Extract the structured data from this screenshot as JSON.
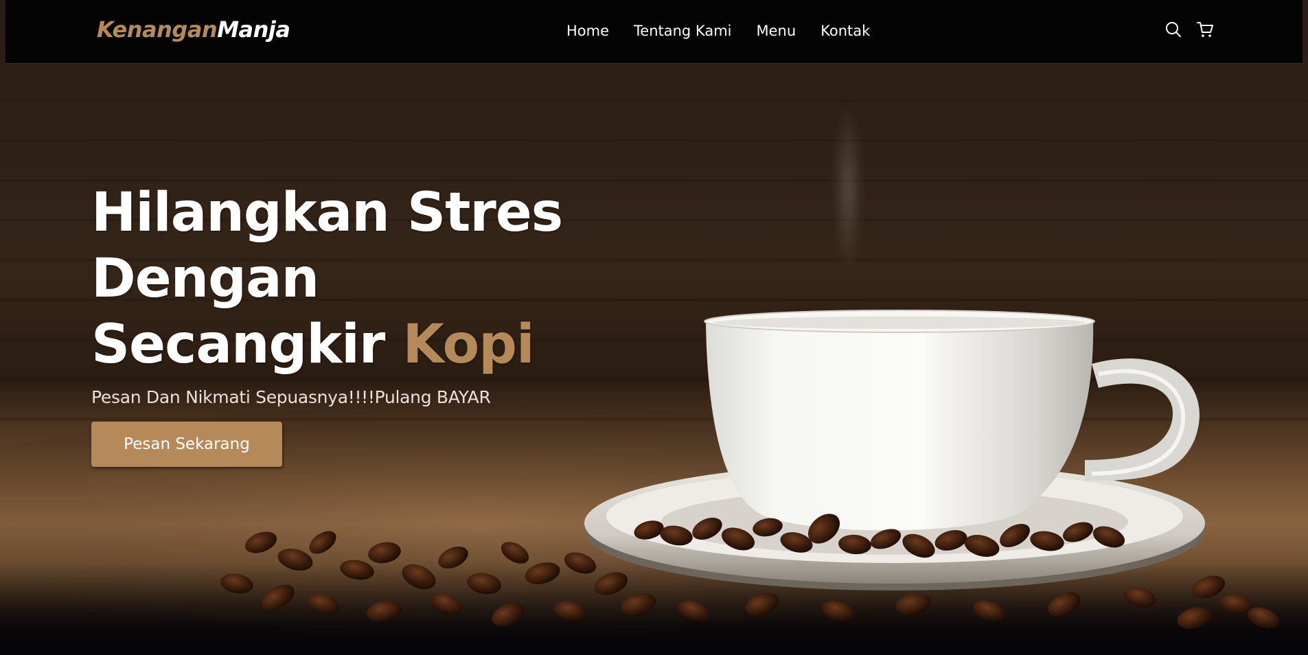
{
  "brand": {
    "name_part1": "Kenangan",
    "name_part2": "Manja",
    "accent_color": "#b6895b"
  },
  "navbar": {
    "links": [
      {
        "label": "Home"
      },
      {
        "label": "Tentang Kami"
      },
      {
        "label": "Menu"
      },
      {
        "label": "Kontak"
      }
    ],
    "icons": [
      "search-icon",
      "shopping-cart-icon"
    ]
  },
  "hero": {
    "title_line1": "Hilangkan Stres",
    "title_line2": "Dengan",
    "title_line3_plain": "Secangkir ",
    "title_line3_accent": "Kopi",
    "subtitle": "Pesan Dan Nikmati Sepuasnya!!!!Pulang BAYAR",
    "cta_label": "Pesan Sekarang",
    "background_image": "coffee-cup-on-saucer-with-coffee-beans"
  }
}
